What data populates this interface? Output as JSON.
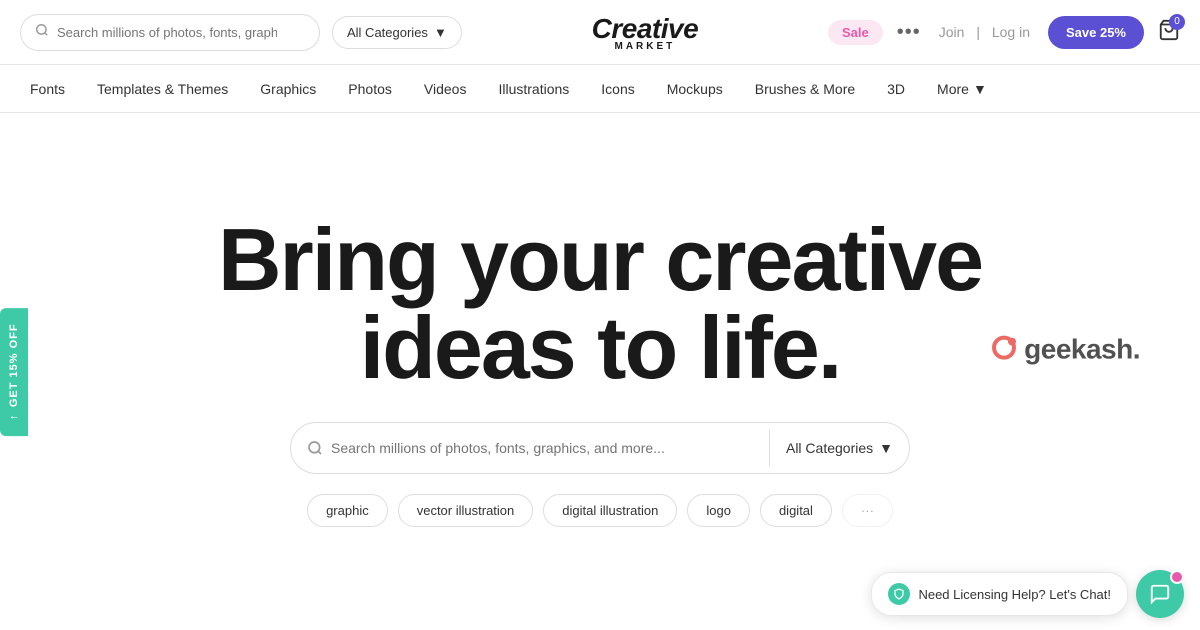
{
  "header": {
    "search_placeholder": "Search millions of photos, fonts, graphics, an...",
    "category_dropdown_label": "All Categories",
    "logo_line1": "Creative",
    "logo_line2": "MARKET",
    "sale_label": "Sale",
    "more_icon_label": "•••",
    "join_label": "Join",
    "log_label": "Log in",
    "save_btn_label": "Save 25%",
    "cart_badge": "0"
  },
  "nav": {
    "items": [
      {
        "label": "Fonts",
        "id": "fonts"
      },
      {
        "label": "Templates & Themes",
        "id": "templates"
      },
      {
        "label": "Graphics",
        "id": "graphics"
      },
      {
        "label": "Photos",
        "id": "photos"
      },
      {
        "label": "Videos",
        "id": "videos"
      },
      {
        "label": "Illustrations",
        "id": "illustrations"
      },
      {
        "label": "Icons",
        "id": "icons"
      },
      {
        "label": "Mockups",
        "id": "mockups"
      },
      {
        "label": "Brushes & More",
        "id": "brushes"
      },
      {
        "label": "3D",
        "id": "3d"
      },
      {
        "label": "More",
        "id": "more"
      }
    ]
  },
  "hero": {
    "title_line1": "Bring your creative",
    "title_line2": "ideas to life.",
    "search_placeholder": "Search millions of photos, fonts, graphics, and more...",
    "category_label": "All Categories",
    "watermark_text": "geekash.",
    "pills": [
      {
        "label": "graphic",
        "id": "pill-graphic"
      },
      {
        "label": "vector illustration",
        "id": "pill-vector"
      },
      {
        "label": "digital illustration",
        "id": "pill-digital-illus"
      },
      {
        "label": "logo",
        "id": "pill-logo"
      },
      {
        "label": "digital",
        "id": "pill-digital"
      }
    ]
  },
  "side_discount": {
    "label": "GET 15% OFF"
  },
  "chat": {
    "bubble_text": "Need Licensing Help? Let's Chat!"
  },
  "colors": {
    "accent_purple": "#5b4fd4",
    "accent_teal": "#3ec9a7",
    "accent_pink": "#e85aad",
    "sale_bg": "#fce8f3",
    "sale_text": "#e85aad"
  }
}
